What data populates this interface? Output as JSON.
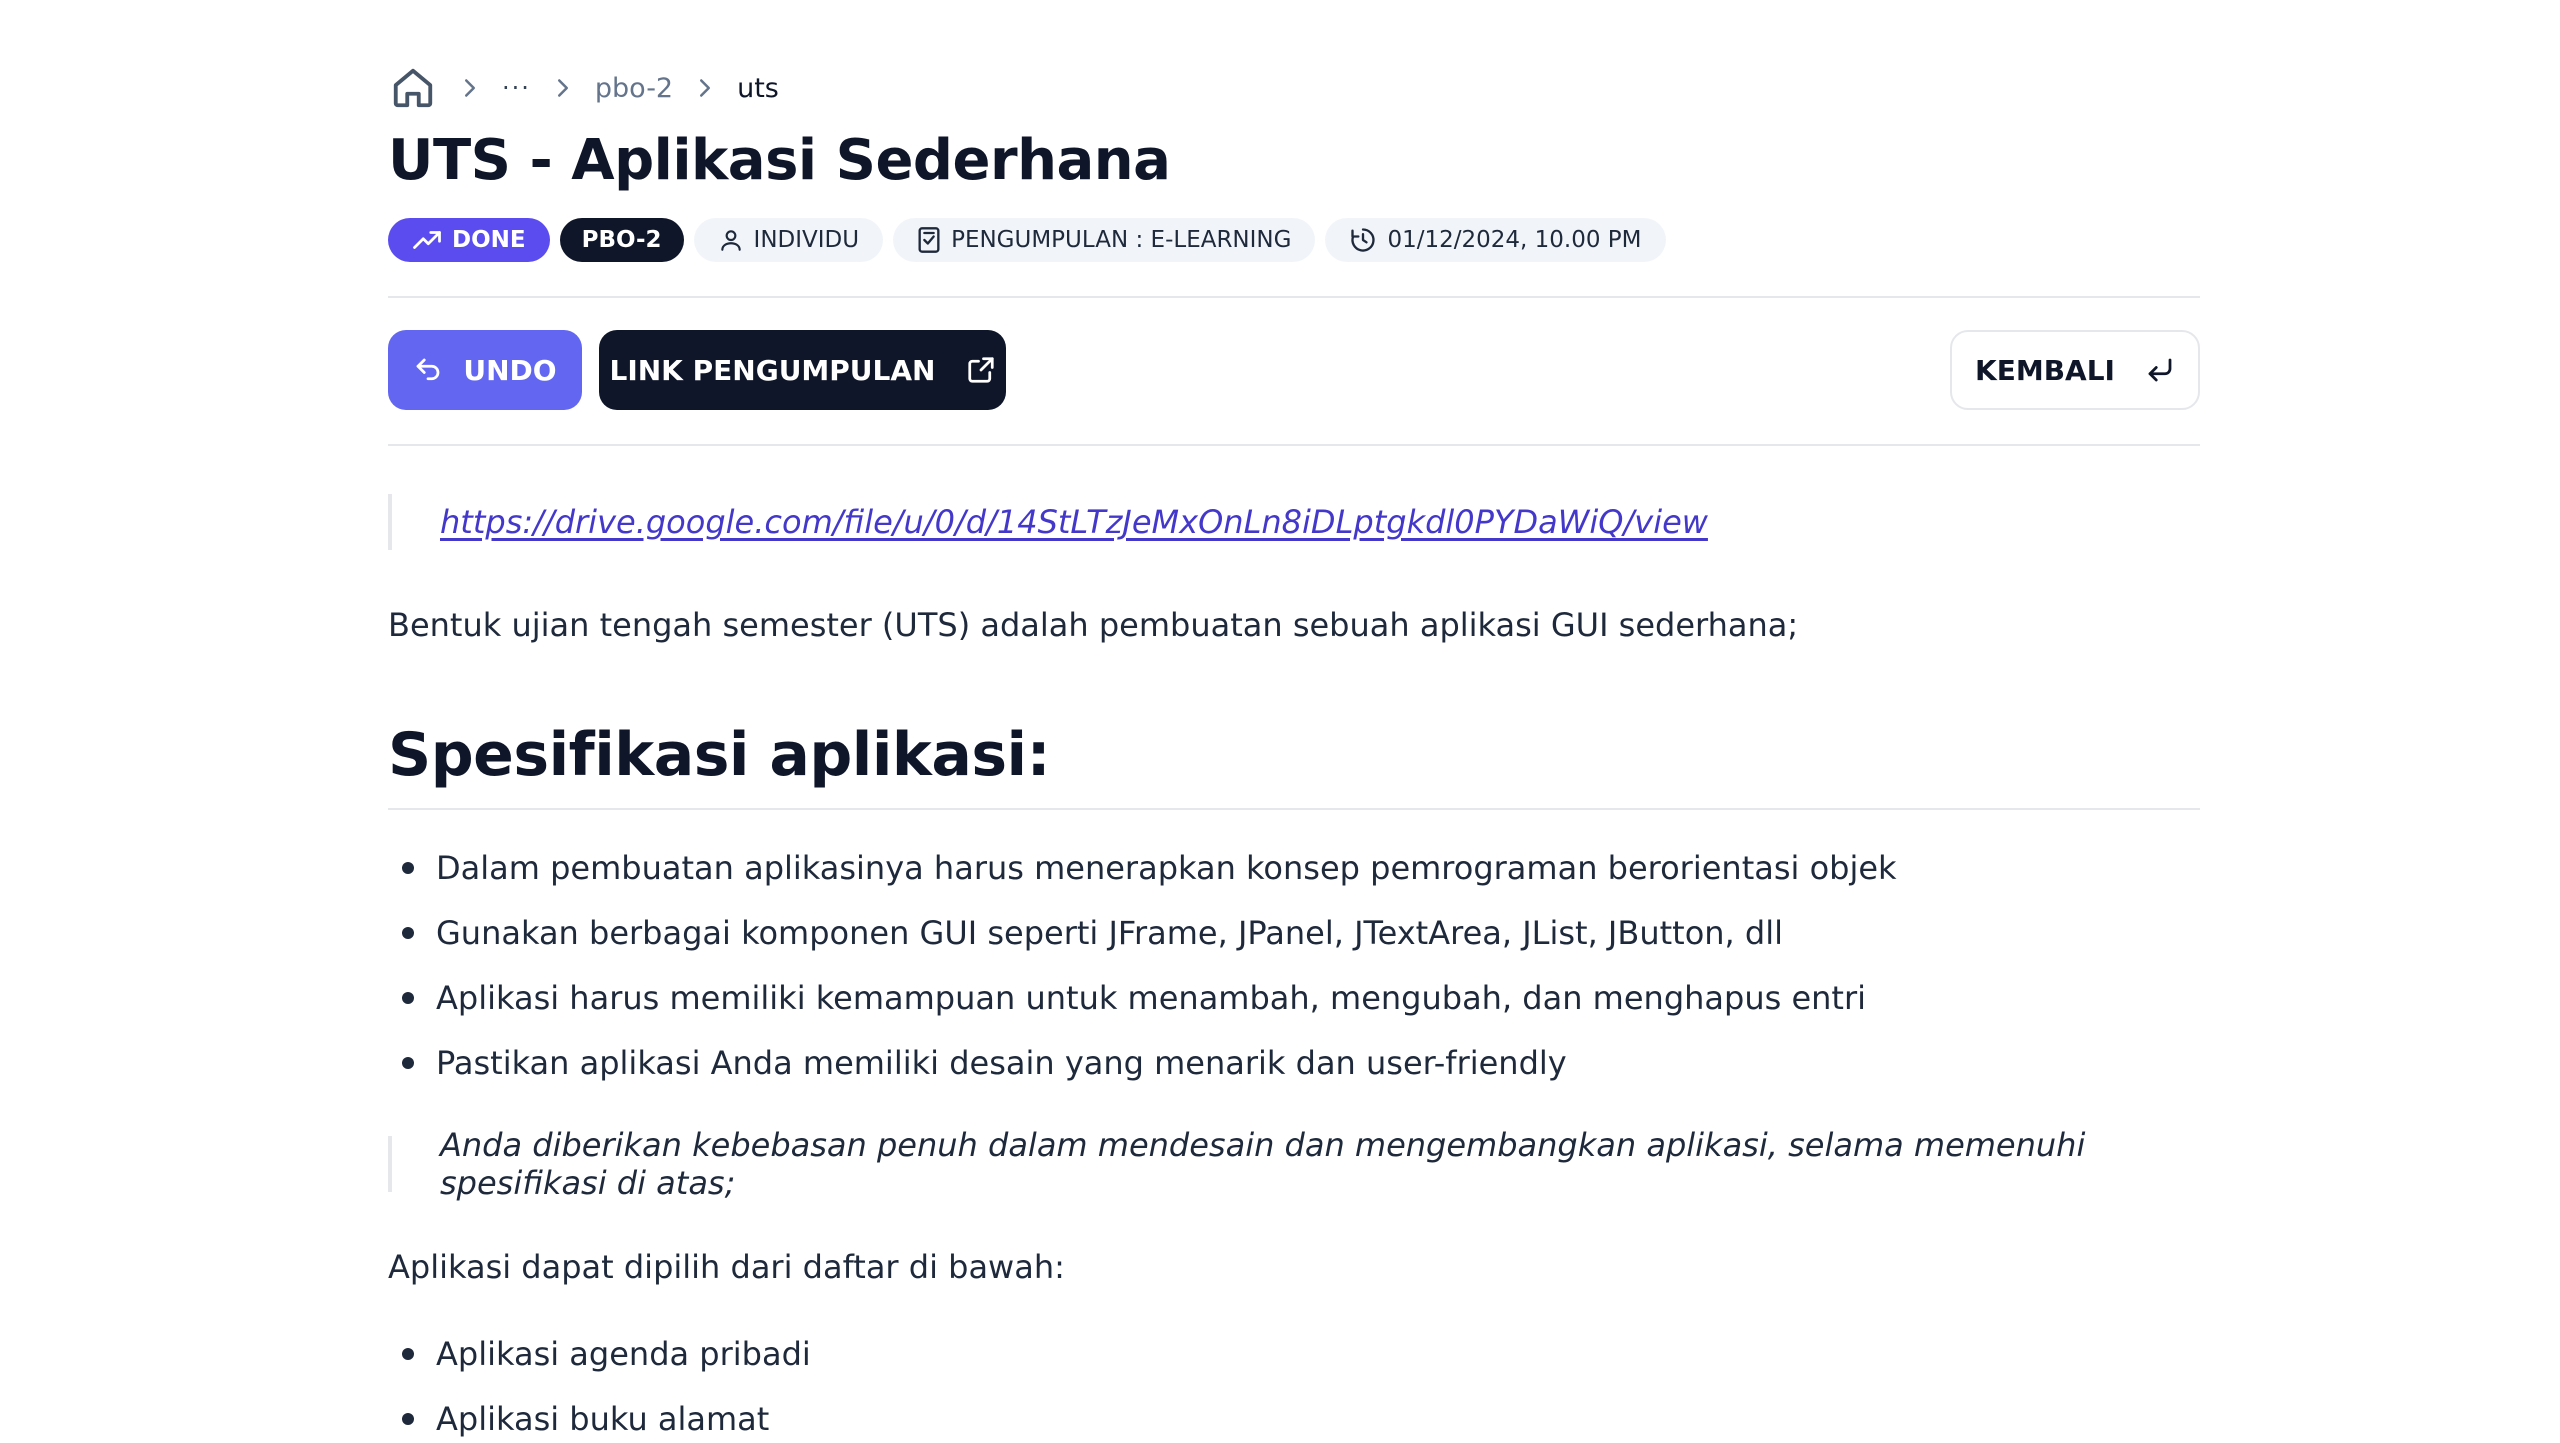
{
  "breadcrumb": {
    "home_icon": "home-icon",
    "ellipsis": "···",
    "items": [
      "pbo-2",
      "uts"
    ]
  },
  "title": "UTS - Aplikasi Sederhana",
  "badges": {
    "status": "DONE",
    "class": "PBO-2",
    "type": "INDIVIDU",
    "submission": "PENGUMPULAN : E-LEARNING",
    "deadline": "01/12/2024, 10.00 PM"
  },
  "actions": {
    "undo_label": "UNDO",
    "link_label": "LINK PENGUMPULAN",
    "back_label": "KEMBALI"
  },
  "content": {
    "drive_link": "https://drive.google.com/file/u/0/d/14StLTzJeMxOnLn8iDLptgkdl0PYDaWiQ/view",
    "intro": "Bentuk ujian tengah semester (UTS) adalah pembuatan sebuah aplikasi GUI sederhana;",
    "spec_heading": "Spesifikasi aplikasi:",
    "spec_items": [
      "Dalam pembuatan aplikasinya harus menerapkan konsep pemrograman berorientasi objek",
      "Gunakan berbagai komponen GUI seperti JFrame, JPanel, JTextArea, JList, JButton, dll",
      "Aplikasi harus memiliki kemampuan untuk menambah, mengubah, dan menghapus entri",
      "Pastikan aplikasi Anda memiliki desain yang menarik dan user-friendly"
    ],
    "note": "Anda diberikan kebebasan penuh dalam mendesain dan mengembangkan aplikasi, selama memenuhi spesifikasi di atas;",
    "choose_text": "Aplikasi dapat dipilih dari daftar di bawah:",
    "app_items": [
      "Aplikasi agenda pribadi",
      "Aplikasi buku alamat"
    ]
  },
  "colors": {
    "accent": "#6366f1",
    "done_badge": "#5b4cf0",
    "dark": "#0f1629",
    "link": "#4338ca"
  }
}
